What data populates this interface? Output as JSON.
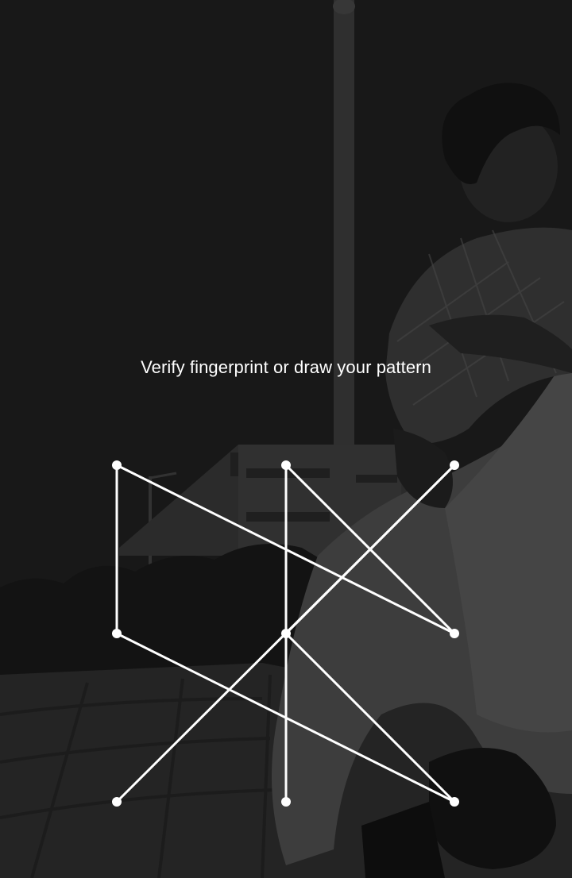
{
  "lock": {
    "prompt": "Verify fingerprint or draw your pattern"
  },
  "pattern": {
    "dot_color": "#ffffff",
    "line_color": "#ffffff",
    "grid": 3,
    "drawn_sequence": [
      7,
      3,
      5,
      9,
      4,
      1,
      6,
      2,
      8
    ]
  },
  "wallpaper": {
    "description_icon": "person-sitting-photo",
    "tint": "#1f1f1f"
  }
}
